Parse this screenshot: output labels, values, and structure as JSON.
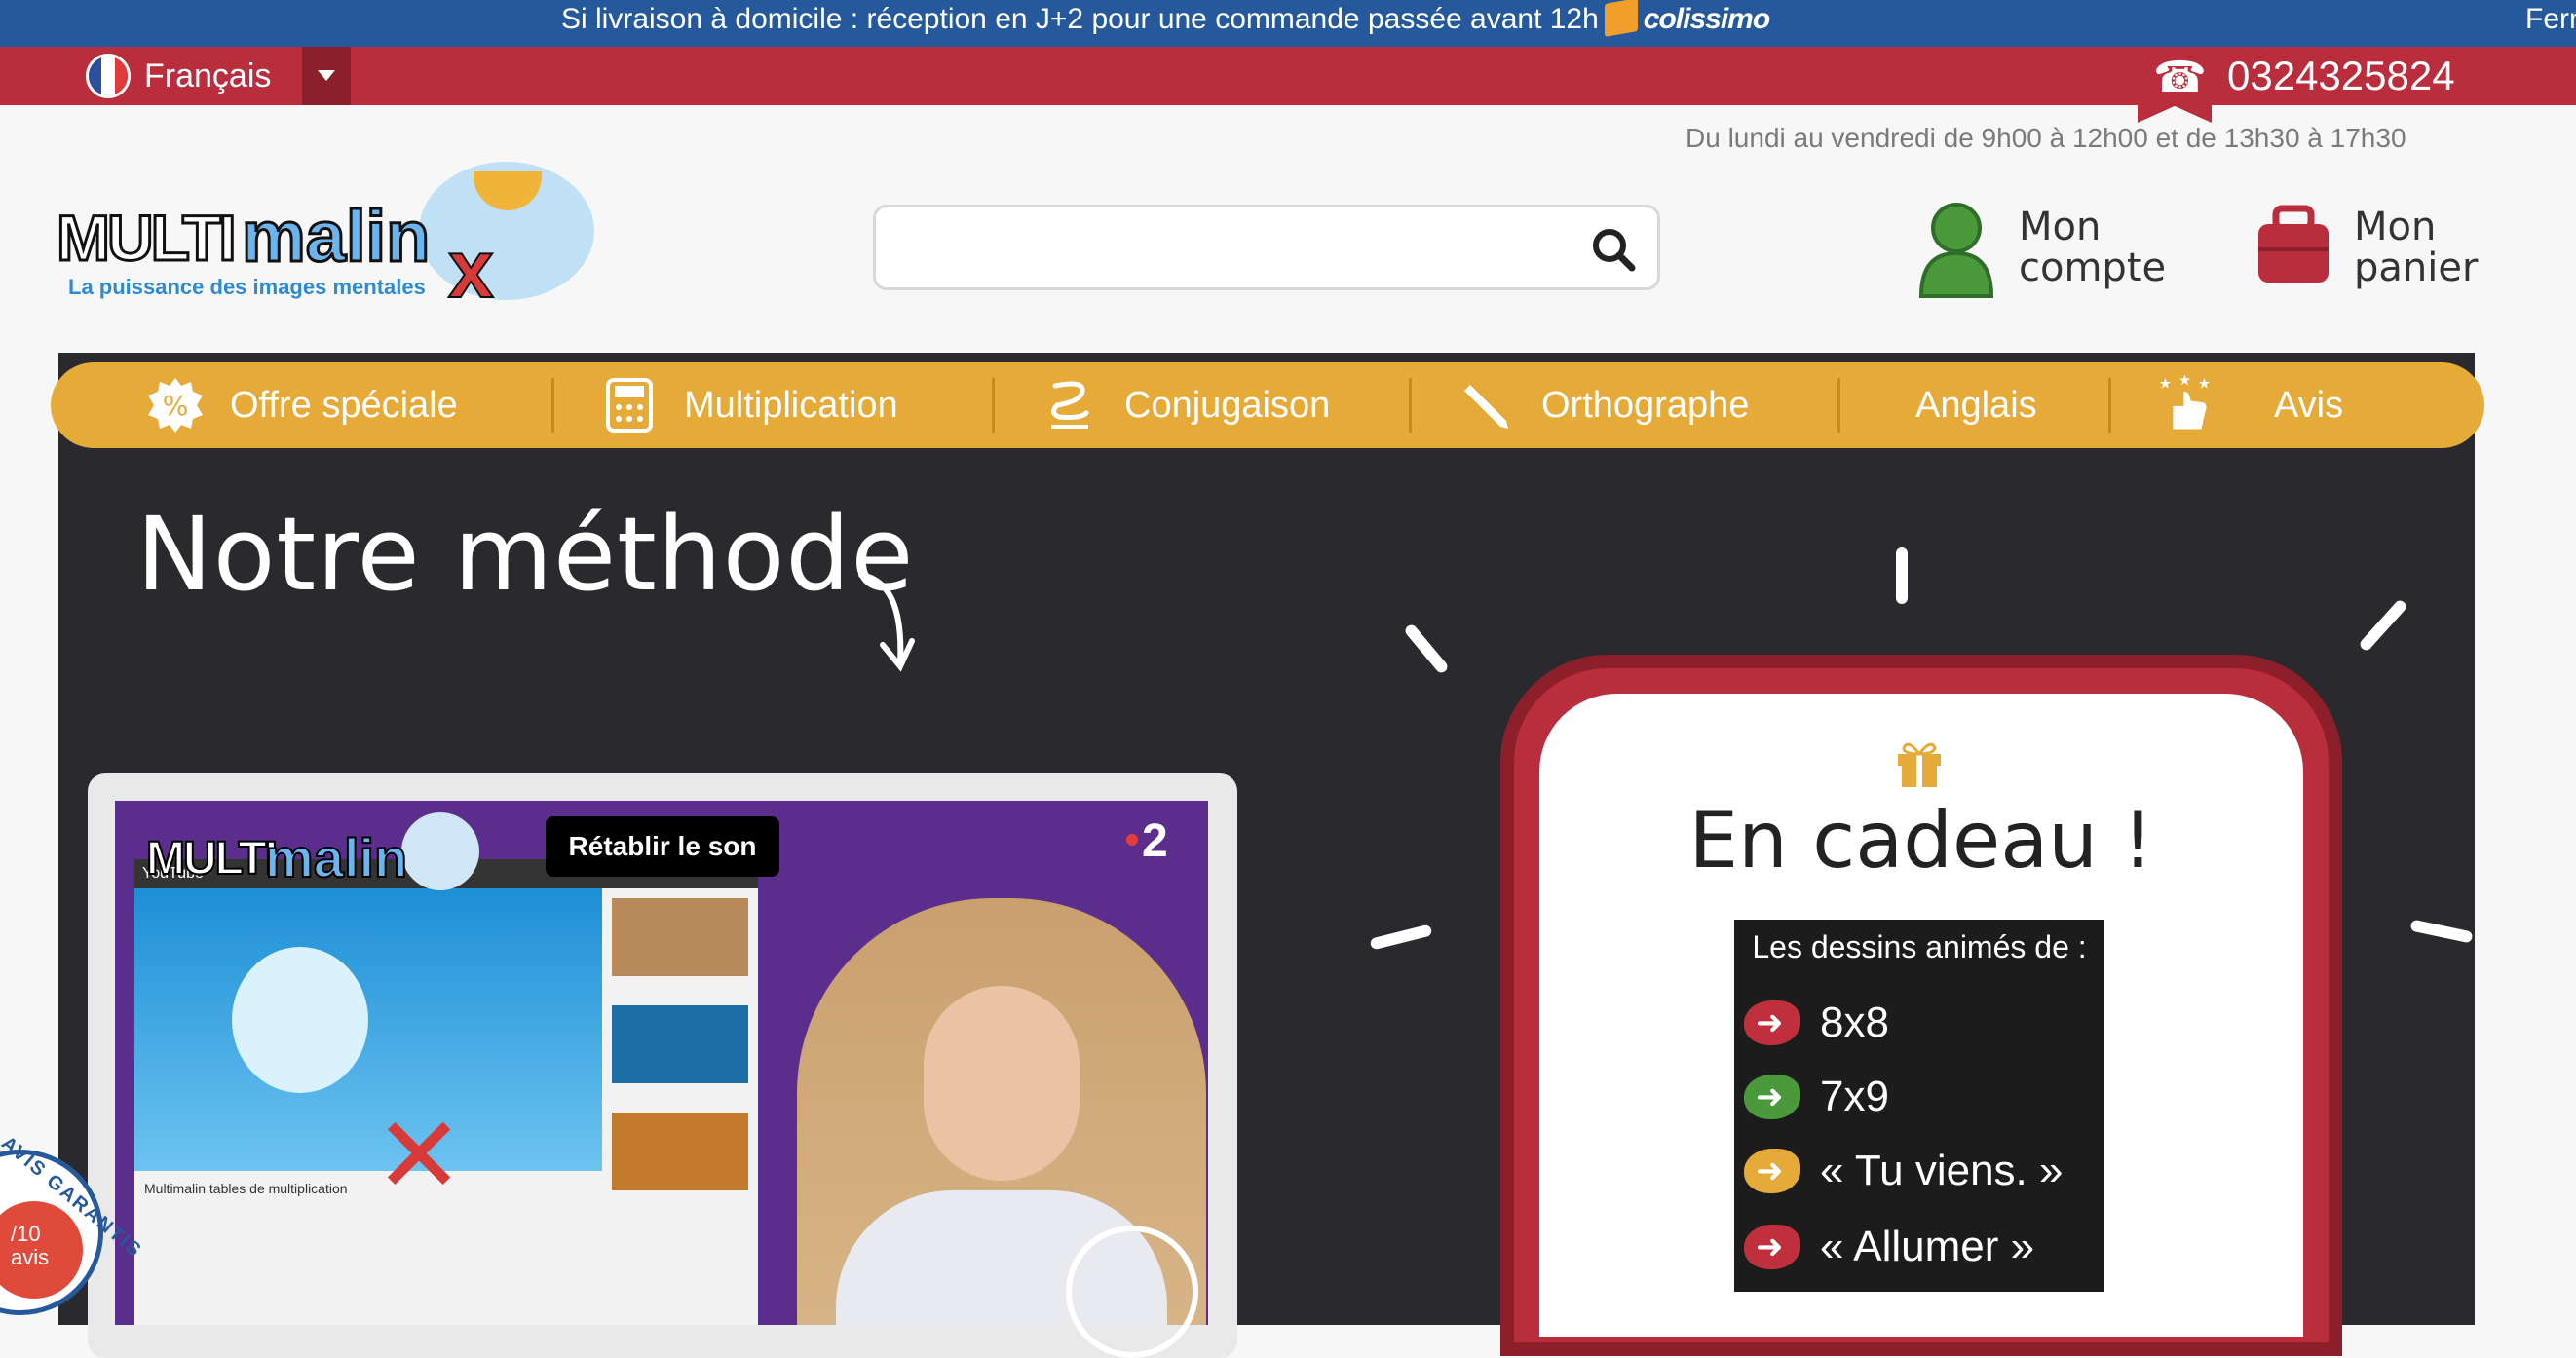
{
  "topbar": {
    "message": "Si livraison à domicile : réception en J+2 pour une commande passée avant 12h",
    "carrier": "colissimo",
    "right_text": "Ferm"
  },
  "lang": {
    "label": "Français"
  },
  "contact": {
    "phone": "0324325824",
    "hours": "Du lundi au vendredi de 9h00 à 12h00 et de 13h30 à 17h30"
  },
  "logo": {
    "part1": "MULTI",
    "part2": "malin",
    "x": "x",
    "tagline": "La puissance des images mentales"
  },
  "search": {
    "placeholder": ""
  },
  "account": {
    "line1": "Mon",
    "line2": "compte"
  },
  "cart": {
    "line1": "Mon",
    "line2": "panier"
  },
  "nav": {
    "items": [
      {
        "label": "Offre spéciale",
        "icon": "percent-badge-icon"
      },
      {
        "label": "Multiplication",
        "icon": "calculator-icon"
      },
      {
        "label": "Conjugaison",
        "icon": "conjugation-icon"
      },
      {
        "label": "Orthographe",
        "icon": "pencil-icon"
      },
      {
        "label": "Anglais",
        "icon": ""
      },
      {
        "label": "Avis",
        "icon": "thumbs-up-stars-icon"
      }
    ]
  },
  "method": {
    "title": "Notre méthode"
  },
  "video": {
    "mute_label": "Rétablir le son",
    "channel": "2",
    "logo_part1": "MULTI",
    "logo_part2": "malin",
    "yt_label": "YouTube",
    "caption": "Multimalin tables de multiplication"
  },
  "gift": {
    "title": "En cadeau !",
    "list_title": "Les dessins animés de :",
    "items": [
      {
        "label": "8x8",
        "color": "#c0303c"
      },
      {
        "label": "7x9",
        "color": "#4a9a3c"
      },
      {
        "label": "« Tu viens. »",
        "color": "#e6aa39"
      },
      {
        "label": "« Allumer »",
        "color": "#c0303c"
      }
    ]
  },
  "badge": {
    "ring": "AVIS GARANTIS",
    "score": "/10",
    "label": "avis"
  },
  "colors": {
    "blue": "#26599b",
    "red": "#b92d3c",
    "nav": "#e6aa39",
    "board": "#2a2a2e"
  }
}
